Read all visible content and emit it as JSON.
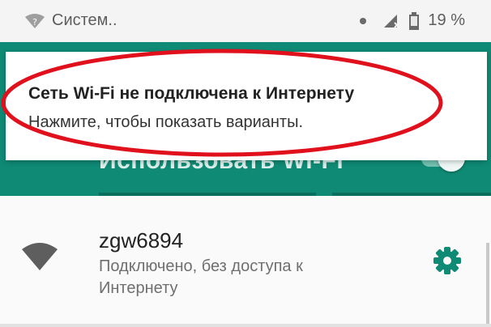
{
  "status_bar": {
    "network_label": "Систем..",
    "battery_percent": "19 %"
  },
  "wifi_screen": {
    "toggle_label": "Использовать Wi-Fi",
    "wifi_enabled": true
  },
  "notification": {
    "title": "Сеть Wi-Fi не подключена к Интернету",
    "text": "Нажмите, чтобы показать варианты."
  },
  "network": {
    "ssid": "zgw6894",
    "status": "Подключено, без доступа к Интернету",
    "icon": "wifi-signal-icon",
    "settings_icon": "gear-icon"
  },
  "colors": {
    "accent": "#0f8a74",
    "annotation": "#e0101c"
  }
}
